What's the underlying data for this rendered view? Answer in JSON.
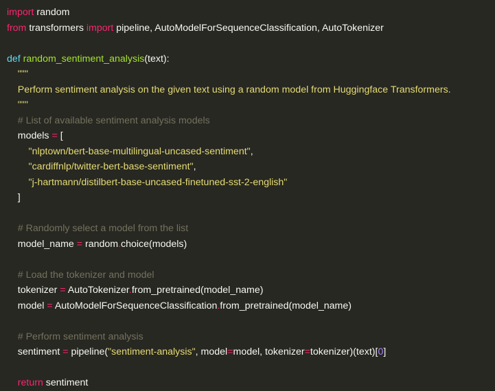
{
  "theme": {
    "background": "#272822",
    "foreground": "#f8f8f2",
    "keyword": "#f92672",
    "storage": "#66d9ef",
    "function_name": "#a6e22e",
    "string": "#e6db74",
    "comment": "#75715e",
    "number": "#ae81ff"
  },
  "code": {
    "l01": {
      "kw": "import",
      "mod": " random"
    },
    "l02": {
      "kw_from": "from",
      "mod": " transformers ",
      "kw_import": "import",
      "names": " pipeline, AutoModelForSequenceClassification, AutoTokenizer"
    },
    "l04": {
      "def": "def",
      "name": " random_sentiment_analysis",
      "params": "(text):"
    },
    "l05": {
      "str": "    \"\"\""
    },
    "l06": {
      "str": "    Perform sentiment analysis on the given text using a random model from Huggingface Transformers."
    },
    "l07": {
      "str": "    \"\"\""
    },
    "l08": {
      "comment": "    # List of available sentiment analysis models"
    },
    "l09": {
      "lhs": "    models ",
      "op": "=",
      "rhs": " ["
    },
    "l10": {
      "indent": "        ",
      "str": "\"nlptown/bert-base-multilingual-uncased-sentiment\"",
      "tail": ","
    },
    "l11": {
      "indent": "        ",
      "str": "\"cardiffnlp/twitter-bert-base-sentiment\"",
      "tail": ","
    },
    "l12": {
      "indent": "        ",
      "str": "\"j-hartmann/distilbert-base-uncased-finetuned-sst-2-english\""
    },
    "l13": {
      "text": "    ]"
    },
    "l15": {
      "comment": "    # Randomly select a model from the list"
    },
    "l16": {
      "lhs": "    model_name ",
      "op": "=",
      "mid": " random",
      "dot": ".",
      "rhs": "choice(models)"
    },
    "l18": {
      "comment": "    # Load the tokenizer and model"
    },
    "l19": {
      "lhs": "    tokenizer ",
      "op": "=",
      "mid": " AutoTokenizer",
      "dot": ".",
      "rhs": "from_pretrained(model_name)"
    },
    "l20": {
      "lhs": "    model ",
      "op": "=",
      "mid": " AutoModelForSequenceClassification",
      "dot": ".",
      "rhs": "from_pretrained(model_name)"
    },
    "l22": {
      "comment": "    # Perform sentiment analysis"
    },
    "l23": {
      "lhs": "    sentiment ",
      "op": "=",
      "call": " pipeline(",
      "str": "\"sentiment-analysis\"",
      "p1": ", model",
      "op2": "=",
      "p2": "model, tokenizer",
      "op3": "=",
      "p3": "tokenizer)(text)[",
      "num": "0",
      "end": "]"
    },
    "l25": {
      "kw": "    return",
      "rest": " sentiment"
    }
  }
}
